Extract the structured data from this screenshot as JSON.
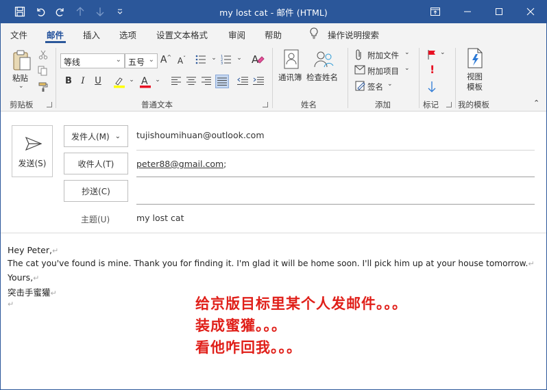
{
  "window": {
    "title": "my lost cat  -  邮件 (HTML)"
  },
  "menu": {
    "tabs": [
      "文件",
      "邮件",
      "插入",
      "选项",
      "设置文本格式",
      "审阅",
      "帮助"
    ],
    "search_label": "操作说明搜索"
  },
  "ribbon": {
    "clipboard": {
      "paste_label": "粘贴",
      "group_label": "剪贴板"
    },
    "basic_text": {
      "font_name": "等线",
      "font_size": "五号",
      "group_label": "普通文本"
    },
    "names": {
      "address_book": "通讯簿",
      "check_names": "检查姓名",
      "group_label": "姓名"
    },
    "include": {
      "attach_file": "附加文件",
      "attach_item": "附加项目",
      "signature": "签名",
      "group_label": "添加"
    },
    "tags": {
      "group_label": "标记"
    },
    "templates": {
      "view_label_1": "视图",
      "view_label_2": "模板",
      "group_label": "我的模板"
    }
  },
  "compose": {
    "send_label": "发送(S)",
    "from_button": "发件人(M)",
    "from_value": "tujishoumihuan@outlook.com",
    "to_button": "收件人(T)",
    "to_value": "peter88@gmail.com",
    "to_suffix": ";",
    "cc_button": "抄送(C)",
    "subject_label": "主题(U)",
    "subject_value": "my lost cat"
  },
  "message_body": {
    "lines": [
      "Hey Peter,",
      "The cat you've found is mine. Thank you for finding it. I'm glad it will be home soon. I'll pick him up at your house tomorrow.",
      "Yours,",
      "突击手蜜獾"
    ],
    "paragraph_mark": "↵"
  },
  "annotation": {
    "lines": [
      "给京版目标里某个人发邮件。。。",
      "装成蜜獾。。。",
      "看他咋回我。。。"
    ]
  },
  "colors": {
    "title_bar": "#2b579a",
    "annotation_red": "#e0201a",
    "highlight_yellow": "#ffff00",
    "font_color_red": "#e81123"
  }
}
